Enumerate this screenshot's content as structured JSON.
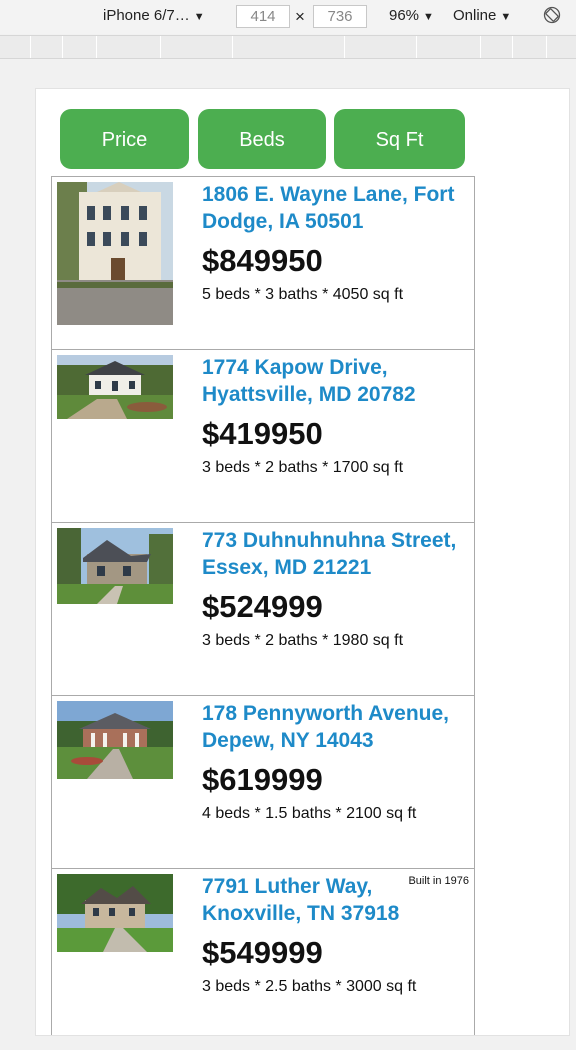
{
  "devtools": {
    "device": "iPhone 6/7…",
    "width": "414",
    "height": "736",
    "times": "×",
    "zoom": "96%",
    "network": "Online",
    "caret": "▼"
  },
  "sort_buttons": [
    {
      "label": "Price"
    },
    {
      "label": "Beds"
    },
    {
      "label": "Sq Ft"
    }
  ],
  "listings": [
    {
      "address": "1806 E. Wayne Lane, Fort Dodge, IA 50501",
      "price": "$849950",
      "specs": "5 beds * 3 baths * 4050 sq ft",
      "built": ""
    },
    {
      "address": "1774 Kapow Drive, Hyattsville, MD 20782",
      "price": "$419950",
      "specs": "3 beds * 2 baths * 1700 sq ft",
      "built": ""
    },
    {
      "address": "773 Duhnuhnuhna Street, Essex, MD 21221",
      "price": "$524999",
      "specs": "3 beds * 2 baths * 1980 sq ft",
      "built": ""
    },
    {
      "address": "178 Pennyworth Avenue, Depew, NY 14043",
      "price": "$619999",
      "specs": "4 beds * 1.5 baths * 2100 sq ft",
      "built": ""
    },
    {
      "address": "7791 Luther Way, Knoxville, TN 37918",
      "price": "$549999",
      "specs": "3 beds * 2.5 baths * 3000 sq ft",
      "built": "Built in 1976"
    }
  ],
  "colors": {
    "button": "#4cae50",
    "link": "#1e8ac8"
  }
}
